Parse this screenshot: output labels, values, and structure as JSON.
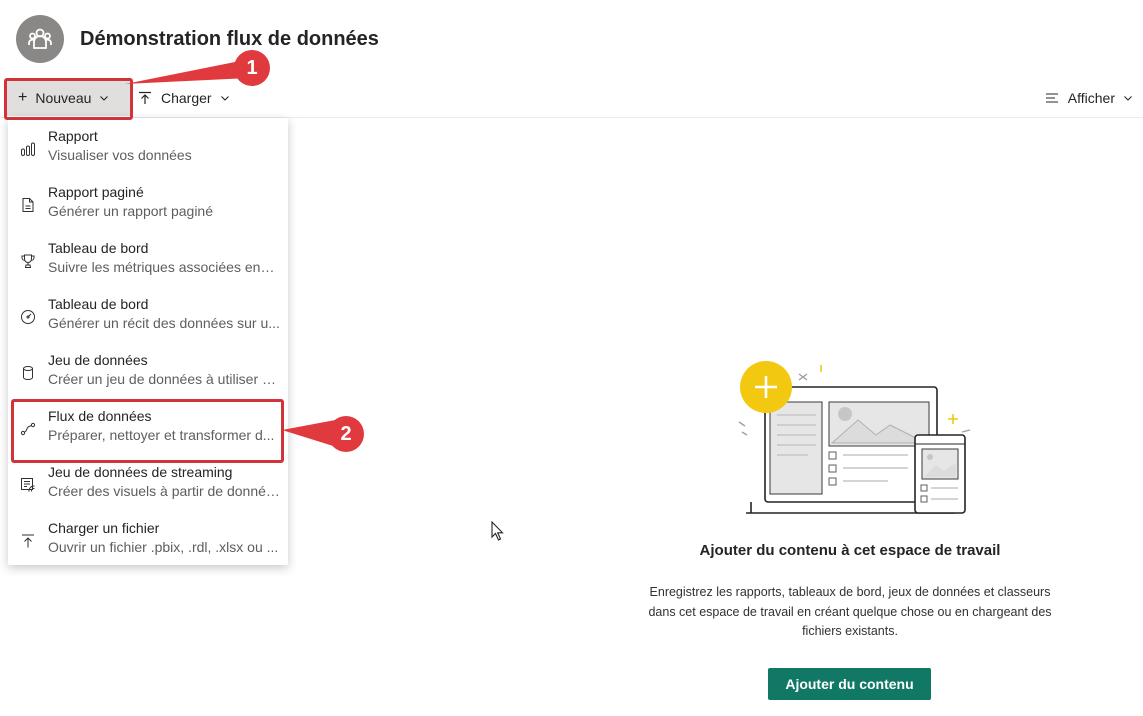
{
  "workspace": {
    "title": "Démonstration flux de données",
    "avatar_icon": "group-icon"
  },
  "toolbar": {
    "new_label": "Nouveau",
    "upload_label": "Charger",
    "view_label": "Afficher"
  },
  "menu": {
    "items": [
      {
        "title": "Rapport",
        "desc": "Visualiser vos données",
        "icon": "bar-chart-icon"
      },
      {
        "title": "Rapport paginé",
        "desc": "Générer un rapport paginé",
        "icon": "paginated-report-icon"
      },
      {
        "title": "Tableau de bord",
        "desc": "Suivre les métriques associées ense...",
        "icon": "trophy-icon"
      },
      {
        "title": "Tableau de bord",
        "desc": "Générer un récit des données sur u...",
        "icon": "gauge-icon"
      },
      {
        "title": "Jeu de données",
        "desc": "Créer un jeu de données à utiliser d...",
        "icon": "database-icon"
      },
      {
        "title": "Flux de données",
        "desc": "Préparer, nettoyer et transformer d...",
        "icon": "dataflow-icon"
      },
      {
        "title": "Jeu de données de streaming",
        "desc": "Créer des visuels à partir de donnée...",
        "icon": "streaming-icon"
      },
      {
        "title": "Charger un fichier",
        "desc": "Ouvrir un fichier .pbix, .rdl, .xlsx ou ...",
        "icon": "upload-icon"
      }
    ]
  },
  "callouts": {
    "step1": "1",
    "step2": "2"
  },
  "empty_state": {
    "title": "Ajouter du contenu à cet espace de travail",
    "description": "Enregistrez les rapports, tableaux de bord, jeux de données et classeurs dans cet espace de travail en créant quelque chose ou en chargeant des fichiers existants.",
    "button_label": "Ajouter du contenu"
  },
  "colors": {
    "accent": "#117865",
    "callout": "#e03a3e",
    "highlight": "#d13438",
    "illustration_yellow": "#f2c811"
  }
}
